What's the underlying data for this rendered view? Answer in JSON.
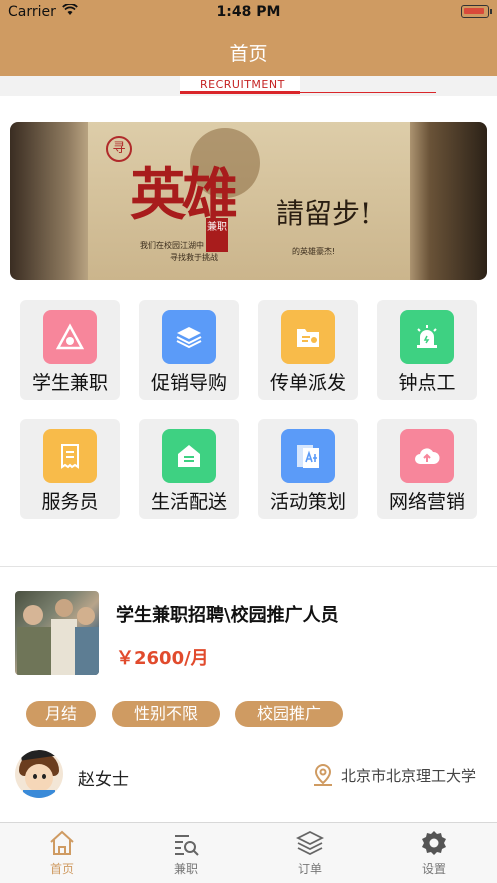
{
  "status_bar": {
    "carrier": "Carrier",
    "time": "1:48 PM"
  },
  "nav": {
    "title": "首页"
  },
  "banner_strip": {
    "text": "RECRUITMENT"
  },
  "hero": {
    "seal": "寻",
    "headline": "英雄",
    "sub": "請留步!",
    "tag": "兼职",
    "line1": "我们在校园江湖中",
    "line2": "寻找救于挑战",
    "line3": "的英雄豪杰!"
  },
  "categories": [
    {
      "label": "学生兼职",
      "icon": "student-icon",
      "color": "#f7869b"
    },
    {
      "label": "促销导购",
      "icon": "layers-icon",
      "color": "#5b9bf8"
    },
    {
      "label": "传单派发",
      "icon": "folder-icon",
      "color": "#f8bb4a"
    },
    {
      "label": "钟点工",
      "icon": "alarm-icon",
      "color": "#3ed182"
    },
    {
      "label": "服务员",
      "icon": "receipt-icon",
      "color": "#f8bb4a"
    },
    {
      "label": "生活配送",
      "icon": "home-icon",
      "color": "#3ed182"
    },
    {
      "label": "活动策划",
      "icon": "document-icon",
      "color": "#5b9bf8"
    },
    {
      "label": "网络营销",
      "icon": "cloud-upload-icon",
      "color": "#f7869b"
    }
  ],
  "job": {
    "title": "学生兼职招聘\\校园推广人员",
    "salary": "￥2600/月",
    "tags": [
      "月结",
      "性别不限",
      "校园推广"
    ],
    "poster": "赵女士",
    "location": "北京市北京理工大学"
  },
  "tabs": [
    {
      "label": "首页",
      "icon": "home-icon",
      "active": true
    },
    {
      "label": "兼职",
      "icon": "search-list-icon",
      "active": false
    },
    {
      "label": "订单",
      "icon": "layers-icon",
      "active": false
    },
    {
      "label": "设置",
      "icon": "gear-icon",
      "active": false
    }
  ],
  "colors": {
    "brand": "#cf9b62",
    "price": "#e14b2d"
  }
}
